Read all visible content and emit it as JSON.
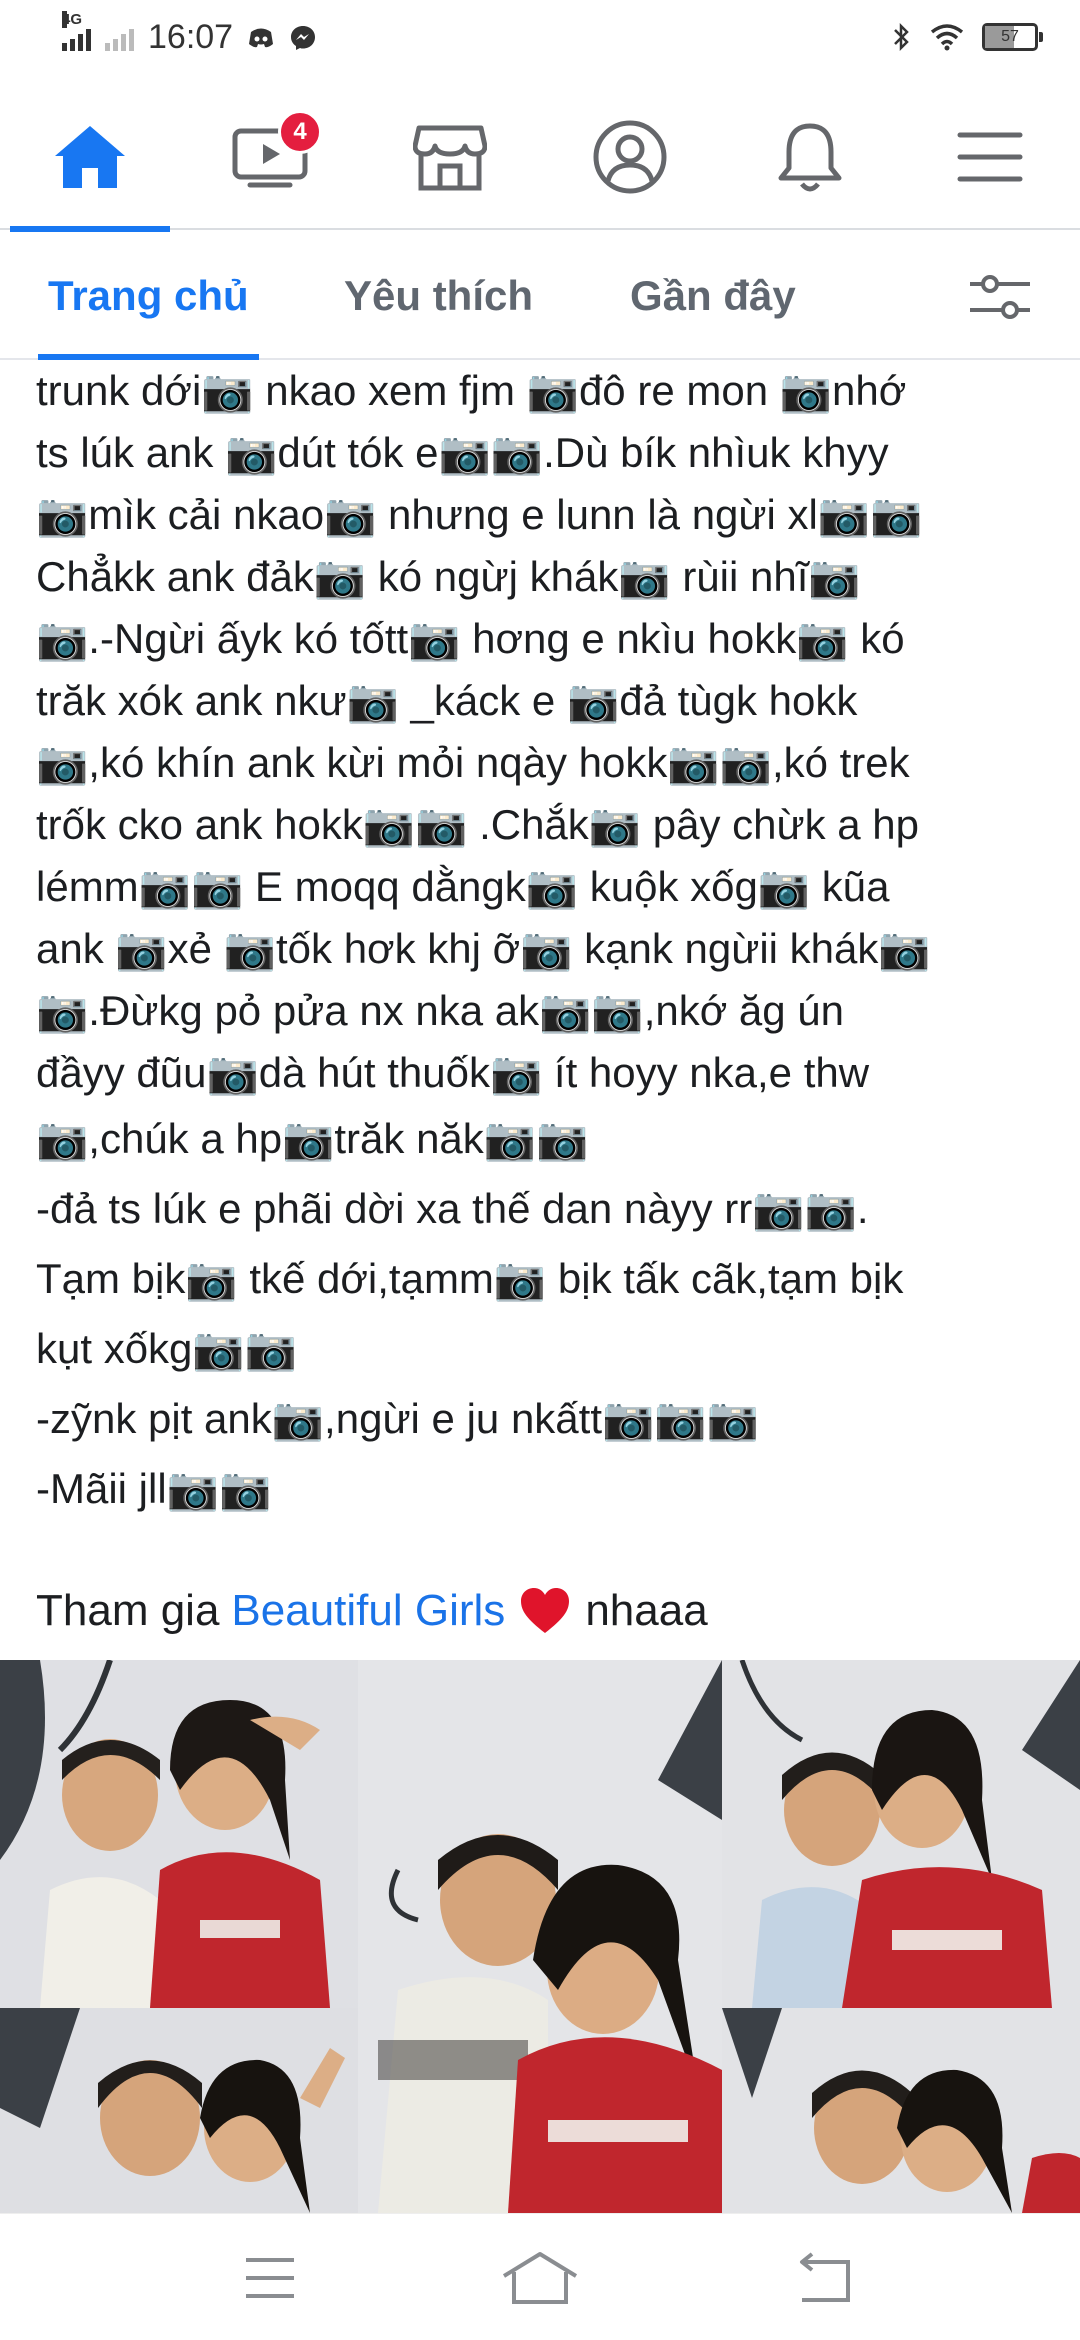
{
  "status_bar": {
    "network": "4G",
    "time": "16:07",
    "battery": "57",
    "battery_level": 0.57,
    "icons_left": [
      "discord-icon",
      "messenger-icon"
    ],
    "icons_right": [
      "bluetooth-icon",
      "wifi-icon",
      "battery-icon"
    ]
  },
  "top_nav": {
    "items": [
      {
        "name": "home",
        "icon": "home-icon",
        "active": true
      },
      {
        "name": "watch",
        "icon": "video-icon",
        "badge": "4"
      },
      {
        "name": "marketplace",
        "icon": "store-icon"
      },
      {
        "name": "profile",
        "icon": "profile-icon"
      },
      {
        "name": "notifications",
        "icon": "bell-icon"
      },
      {
        "name": "menu",
        "icon": "hamburger-icon"
      }
    ]
  },
  "tabs": {
    "items": [
      "Trang chủ",
      "Yêu thích",
      "Gần đây"
    ],
    "active": 0,
    "filter_icon": "sliders-icon"
  },
  "post": {
    "lines": [
      "trunk dới📷 nkao xem fjm 📷đô re mon 📷nhớ",
      "ts lúk ank 📷dút tók e📷📷.Dù bík nhìuk khyy",
      "📷mìk cải nkao📷 nhưng e lunn là ngừi xl📷📷",
      "Chẳkk ank đảk📷 kó ngừj khák📷 rùii nhĩ📷",
      "📷.-Ngừi ấyk kó tốtt📷 hơng e nkìu hokk📷 kó",
      "trăk xók ank nkư📷 _káck e 📷đả tùgk hokk",
      "📷,kó khín ank kừi mỏi nqày hokk📷📷,kó trek",
      "trốk cko ank hokk📷📷 .Chắk📷 pây chừk a hp",
      "lémm📷📷 E moqq dằngk📷 kuộk xốg📷 kũa",
      "ank 📷xẻ 📷tốk hơk khj ỡ📷 kạnk ngừii khák📷",
      "📷.Đừkg pỏ pửa nx nka ak📷📷,nkớ ăg ún",
      "đầyy đũu📷dà hút thuốk📷 ít hoyy nka,e thw",
      "📷,chúk a hp📷trăk năk📷📷",
      "-đả ts lúk e phãi dời xa thế dan nàyy rr📷📷.",
      "Tạm bịk📷 tkế dới,tạmm📷 bịk tấk cãk,tạm bịk",
      "kụt xốkg📷📷",
      "-zỹnk pịt ank📷,ngừi e ju nkấtt📷📷📷",
      "-Mãii jll📷📷"
    ],
    "cta_prefix": "Tham gia",
    "cta_link": "Beautiful Girls",
    "cta_suffix": "nhaaa"
  },
  "photos": [
    {
      "name": "photo-1"
    },
    {
      "name": "photo-2"
    },
    {
      "name": "photo-3"
    },
    {
      "name": "photo-4"
    },
    {
      "name": "photo-5"
    }
  ],
  "nav_bar": {
    "items": [
      {
        "name": "menu",
        "icon": "menu-lines-icon"
      },
      {
        "name": "home",
        "icon": "android-home-icon"
      },
      {
        "name": "back",
        "icon": "back-arrow-icon"
      }
    ]
  },
  "colors": {
    "accent": "#1877f2",
    "badge": "#e41e3f",
    "link": "#1a73e8",
    "heart": "#e0142b",
    "photo_red_shirt": "#c0262d"
  }
}
